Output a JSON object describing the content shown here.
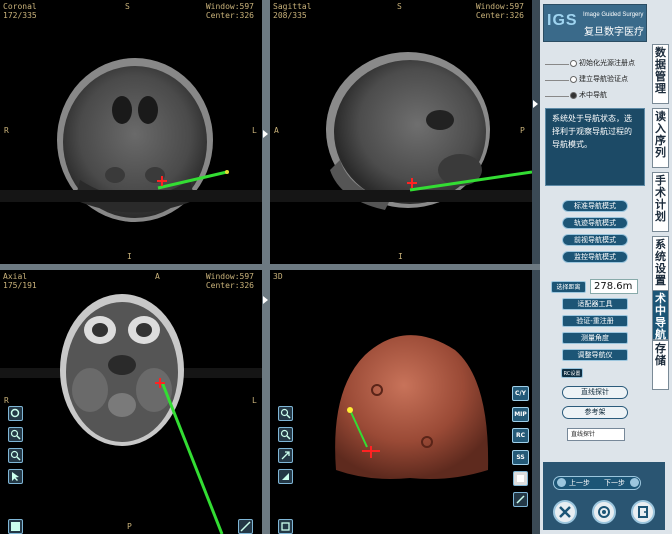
{
  "viewports": {
    "coronal": {
      "name": "Coronal",
      "slice": "172/335",
      "window": "Window:597",
      "center": "Center:326",
      "top": "S",
      "bottom": "I",
      "left": "R",
      "right": "L"
    },
    "sagittal": {
      "name": "Sagittal",
      "slice": "208/335",
      "window": "Window:597",
      "center": "Center:326",
      "top": "S",
      "bottom": "I",
      "left": "A",
      "right": "P"
    },
    "axial": {
      "name": "Axial",
      "slice": "175/191",
      "window": "Window:597",
      "center": "Center:326",
      "top": "A",
      "bottom": "P",
      "left": "R",
      "right": "L"
    },
    "view3d": {
      "name": "3D"
    }
  },
  "view3d_tools": [
    "C/Y",
    "MIP",
    "RC",
    "SS"
  ],
  "panel": {
    "logo_igs": "IGS",
    "logo_sub": "Image Guided Surgery",
    "logo_cn": "复旦数字医疗",
    "steps": [
      "初始化光源注册点",
      "建立导航验证点",
      "术中导航"
    ],
    "info_text": "系统处于导航状态，选择利于观察导航过程的导航模式。",
    "mode_buttons": [
      "标准导航模式",
      "轨迹导航模式",
      "前视导航模式",
      "监控导航模式"
    ],
    "distance_label": "选择距离",
    "distance_value": "278.6m",
    "tool_buttons": [
      "适配器工具",
      "验证-重注册",
      "测量角度",
      "调整导航仪"
    ],
    "rc_tag": "RC设置",
    "pill_buttons": [
      "直线探针",
      "参考架"
    ],
    "probe_select": "直线探针",
    "nav_prev": "上一步",
    "nav_next": "下一步"
  },
  "tabs": [
    "数据管理",
    "读入序列",
    "手术计划",
    "系统设置",
    "术中导航",
    "存储"
  ],
  "colors": {
    "probe": "#33dd33",
    "marker": "#ff2222",
    "accent": "#1c5576",
    "overlay_text": "#c9b27a"
  }
}
